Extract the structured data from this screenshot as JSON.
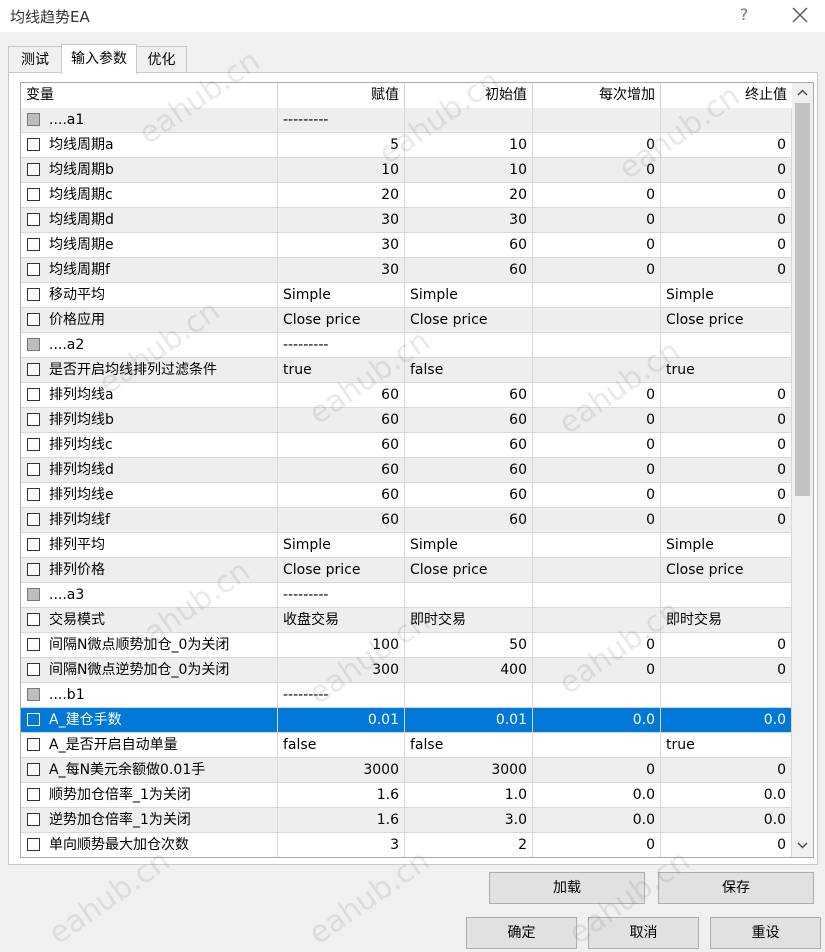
{
  "window": {
    "title": "均线趋势EA",
    "help": "?"
  },
  "tabs": [
    {
      "label": "测试",
      "active": false
    },
    {
      "label": "输入参数",
      "active": true
    },
    {
      "label": "优化",
      "active": false
    }
  ],
  "grid": {
    "columns": [
      "变量",
      "赋值",
      "初始值",
      "每次增加",
      "终止值"
    ],
    "rows": [
      [
        "....a1",
        "---------",
        "",
        "",
        ""
      ],
      [
        "均线周期a",
        "5",
        "10",
        "0",
        "0"
      ],
      [
        "均线周期b",
        "10",
        "10",
        "0",
        "0"
      ],
      [
        "均线周期c",
        "20",
        "20",
        "0",
        "0"
      ],
      [
        "均线周期d",
        "30",
        "30",
        "0",
        "0"
      ],
      [
        "均线周期e",
        "30",
        "60",
        "0",
        "0"
      ],
      [
        "均线周期f",
        "30",
        "60",
        "0",
        "0"
      ],
      [
        "移动平均",
        "Simple",
        "Simple",
        "",
        "Simple"
      ],
      [
        "价格应用",
        "Close price",
        "Close price",
        "",
        "Close price"
      ],
      [
        "....a2",
        "---------",
        "",
        "",
        ""
      ],
      [
        "是否开启均线排列过滤条件",
        "true",
        "false",
        "",
        "true"
      ],
      [
        "排列均线a",
        "60",
        "60",
        "0",
        "0"
      ],
      [
        "排列均线b",
        "60",
        "60",
        "0",
        "0"
      ],
      [
        "排列均线c",
        "60",
        "60",
        "0",
        "0"
      ],
      [
        "排列均线d",
        "60",
        "60",
        "0",
        "0"
      ],
      [
        "排列均线e",
        "60",
        "60",
        "0",
        "0"
      ],
      [
        "排列均线f",
        "60",
        "60",
        "0",
        "0"
      ],
      [
        "排列平均",
        "Simple",
        "Simple",
        "",
        "Simple"
      ],
      [
        "排列价格",
        "Close price",
        "Close price",
        "",
        "Close price"
      ],
      [
        "....a3",
        "---------",
        "",
        "",
        ""
      ],
      [
        "交易模式",
        "收盘交易",
        "即时交易",
        "",
        "即时交易"
      ],
      [
        "间隔N微点顺势加仓_0为关闭",
        "100",
        "50",
        "0",
        "0"
      ],
      [
        "间隔N微点逆势加仓_0为关闭",
        "300",
        "400",
        "0",
        "0"
      ],
      [
        "....b1",
        "---------",
        "",
        "",
        ""
      ],
      [
        "A_建仓手数",
        "0.01",
        "0.01",
        "0.0",
        "0.0"
      ],
      [
        "A_是否开启自动单量",
        "false",
        "false",
        "",
        "true"
      ],
      [
        "A_每N美元余额做0.01手",
        "3000",
        "3000",
        "0",
        "0"
      ],
      [
        "顺势加仓倍率_1为关闭",
        "1.6",
        "1.0",
        "0.0",
        "0.0"
      ],
      [
        "逆势加仓倍率_1为关闭",
        "1.6",
        "3.0",
        "0.0",
        "0.0"
      ],
      [
        "单向顺势最大加仓次数",
        "3",
        "2",
        "0",
        "0"
      ]
    ],
    "group_rows": [
      0,
      9,
      19,
      23
    ],
    "selected_row": 24
  },
  "buttons": {
    "load": "加载",
    "save": "保存",
    "ok": "确定",
    "cancel": "取消",
    "reset": "重设"
  },
  "watermark_text": "eahub.cn",
  "colors": {
    "selection": "#0078d7",
    "alt_row": "#eeeeee"
  }
}
